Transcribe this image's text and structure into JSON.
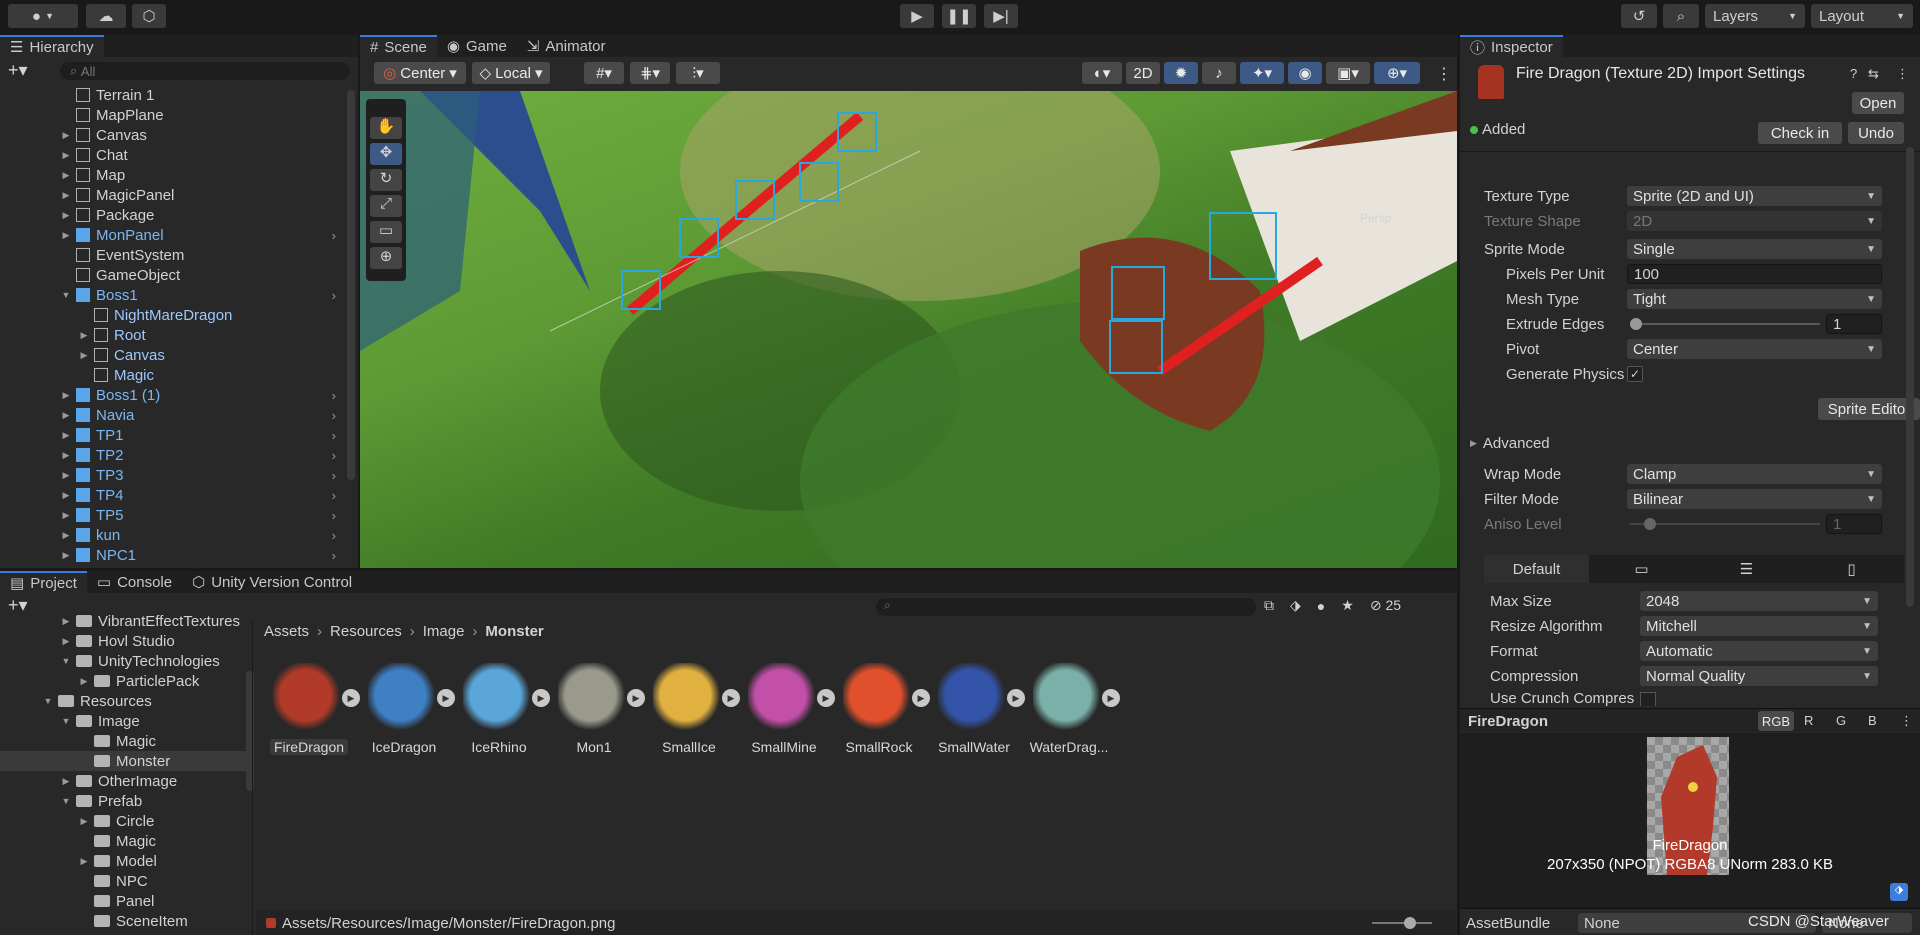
{
  "toolbar": {
    "account_icon": "account-icon",
    "cloud_icon": "cloud-icon",
    "layers": "Layers",
    "layout": "Layout"
  },
  "hierarchy": {
    "tab": "Hierarchy",
    "search_placeholder": "All",
    "items": [
      {
        "label": "Terrain 1",
        "indent": 0,
        "prefab": false,
        "fold": false
      },
      {
        "label": "MapPlane",
        "indent": 0,
        "prefab": false,
        "fold": false
      },
      {
        "label": "Canvas",
        "indent": 0,
        "prefab": false,
        "fold": true
      },
      {
        "label": "Chat",
        "indent": 0,
        "prefab": false,
        "fold": true
      },
      {
        "label": "Map",
        "indent": 0,
        "prefab": false,
        "fold": true
      },
      {
        "label": "MagicPanel",
        "indent": 0,
        "prefab": false,
        "fold": true
      },
      {
        "label": "Package",
        "indent": 0,
        "prefab": false,
        "fold": true
      },
      {
        "label": "MonPanel",
        "indent": 0,
        "prefab": true,
        "fold": true,
        "arrow": true
      },
      {
        "label": "EventSystem",
        "indent": 0,
        "prefab": false,
        "fold": false
      },
      {
        "label": "GameObject",
        "indent": 0,
        "prefab": false,
        "fold": false
      },
      {
        "label": "Boss1",
        "indent": 0,
        "prefab": true,
        "fold": true,
        "open": true,
        "arrow": true
      },
      {
        "label": "NightMareDragon",
        "indent": 1,
        "prefab": false,
        "fold": false,
        "blue": true
      },
      {
        "label": "Root",
        "indent": 1,
        "prefab": false,
        "fold": true,
        "blue": true
      },
      {
        "label": "Canvas",
        "indent": 1,
        "prefab": false,
        "fold": true,
        "blue": true
      },
      {
        "label": "Magic",
        "indent": 1,
        "prefab": false,
        "fold": false,
        "blue": true
      },
      {
        "label": "Boss1 (1)",
        "indent": 0,
        "prefab": true,
        "fold": true,
        "arrow": true
      },
      {
        "label": "Navia",
        "indent": 0,
        "prefab": true,
        "fold": true,
        "arrow": true
      },
      {
        "label": "TP1",
        "indent": 0,
        "prefab": true,
        "fold": true,
        "arrow": true
      },
      {
        "label": "TP2",
        "indent": 0,
        "prefab": true,
        "fold": true,
        "arrow": true
      },
      {
        "label": "TP3",
        "indent": 0,
        "prefab": true,
        "fold": true,
        "arrow": true
      },
      {
        "label": "TP4",
        "indent": 0,
        "prefab": true,
        "fold": true,
        "arrow": true
      },
      {
        "label": "TP5",
        "indent": 0,
        "prefab": true,
        "fold": true,
        "arrow": true
      },
      {
        "label": "kun",
        "indent": 0,
        "prefab": true,
        "fold": true,
        "arrow": true
      },
      {
        "label": "NPC1",
        "indent": 0,
        "prefab": true,
        "fold": true,
        "arrow": true
      }
    ]
  },
  "scene": {
    "tabs": [
      "Scene",
      "Game",
      "Animator"
    ],
    "pivot_center": "Center",
    "pivot_local": "Local",
    "mode_2d": "2D",
    "persp": "Persp"
  },
  "inspector": {
    "tab": "Inspector",
    "title": "Fire Dragon (Texture 2D) Import Settings",
    "open": "Open",
    "added": "Added",
    "check_in": "Check in",
    "undo": "Undo",
    "rows": {
      "texture_type": {
        "label": "Texture Type",
        "value": "Sprite (2D and UI)"
      },
      "texture_shape": {
        "label": "Texture Shape",
        "value": "2D"
      },
      "sprite_mode": {
        "label": "Sprite Mode",
        "value": "Single"
      },
      "ppu": {
        "label": "Pixels Per Unit",
        "value": "100"
      },
      "mesh_type": {
        "label": "Mesh Type",
        "value": "Tight"
      },
      "extrude": {
        "label": "Extrude Edges",
        "value": "1"
      },
      "pivot": {
        "label": "Pivot",
        "value": "Center"
      },
      "gen_phys": {
        "label": "Generate Physics"
      },
      "wrap": {
        "label": "Wrap Mode",
        "value": "Clamp"
      },
      "filter": {
        "label": "Filter Mode",
        "value": "Bilinear"
      },
      "aniso": {
        "label": "Aniso Level",
        "value": "1"
      },
      "max_size": {
        "label": "Max Size",
        "value": "2048"
      },
      "resize": {
        "label": "Resize Algorithm",
        "value": "Mitchell"
      },
      "format": {
        "label": "Format",
        "value": "Automatic"
      },
      "compression": {
        "label": "Compression",
        "value": "Normal Quality"
      },
      "crunch": {
        "label": "Use Crunch Compres"
      }
    },
    "sprite_editor": "Sprite Editor",
    "advanced": "Advanced",
    "platform_default": "Default",
    "preview_name": "FireDragon",
    "channels": [
      "RGB",
      "R",
      "G",
      "B"
    ],
    "preview_label": "FireDragon",
    "preview_info": "207x350 (NPOT)  RGBA8 UNorm   283.0 KB",
    "assetbundle_label": "AssetBundle",
    "assetbundle_value": "None",
    "assetbundle_variant": "None",
    "watermark": "CSDN @StarWeaver"
  },
  "project": {
    "tabs": [
      "Project",
      "Console",
      "Unity Version Control"
    ],
    "count": "25",
    "breadcrumb": [
      "Assets",
      "Resources",
      "Image",
      "Monster"
    ],
    "path": "Assets/Resources/Image/Monster/FireDragon.png",
    "tree": [
      {
        "label": "VibrantEffectTextures",
        "indent": 2,
        "fold": true
      },
      {
        "label": "Hovl Studio",
        "indent": 2,
        "fold": true
      },
      {
        "label": "UnityTechnologies",
        "indent": 2,
        "fold": true,
        "open": true
      },
      {
        "label": "ParticlePack",
        "indent": 3,
        "fold": true
      },
      {
        "label": "Resources",
        "indent": 1,
        "fold": true,
        "open": true
      },
      {
        "label": "Image",
        "indent": 2,
        "fold": true,
        "open": true
      },
      {
        "label": "Magic",
        "indent": 3,
        "fold": false
      },
      {
        "label": "Monster",
        "indent": 3,
        "fold": false,
        "selected": true
      },
      {
        "label": "OtherImage",
        "indent": 2,
        "fold": true
      },
      {
        "label": "Prefab",
        "indent": 2,
        "fold": true,
        "open": true
      },
      {
        "label": "Circle",
        "indent": 3,
        "fold": true
      },
      {
        "label": "Magic",
        "indent": 3,
        "fold": false
      },
      {
        "label": "Model",
        "indent": 3,
        "fold": true
      },
      {
        "label": "NPC",
        "indent": 3,
        "fold": false
      },
      {
        "label": "Panel",
        "indent": 3,
        "fold": false
      },
      {
        "label": "SceneItem",
        "indent": 3,
        "fold": false
      }
    ],
    "assets": [
      {
        "label": "FireDragon",
        "color": "#b23a2a",
        "selected": true
      },
      {
        "label": "IceDragon",
        "color": "#3f7fc4"
      },
      {
        "label": "IceRhino",
        "color": "#5aa6d8"
      },
      {
        "label": "Mon1",
        "color": "#9a9a8c"
      },
      {
        "label": "SmallIce",
        "color": "#e0b040"
      },
      {
        "label": "SmallMine",
        "color": "#c24fa8"
      },
      {
        "label": "SmallRock",
        "color": "#e0502c"
      },
      {
        "label": "SmallWater",
        "color": "#3354a8"
      },
      {
        "label": "WaterDrag...",
        "color": "#7ab0a8"
      }
    ]
  }
}
